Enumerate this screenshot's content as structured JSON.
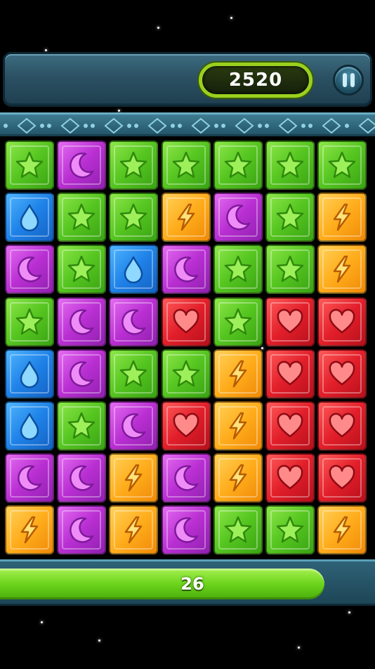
{
  "hud": {
    "score": "2520",
    "pause_icon": "pause-icon"
  },
  "moves": {
    "label": "26",
    "progress_fraction": 0.865
  },
  "colors": {
    "green": "#55c520",
    "purple": "#b92fd2",
    "blue": "#1f82e8",
    "orange": "#ffad1c",
    "red": "#e21f2a",
    "score_ring": "#9ad01e"
  },
  "tile_types": {
    "G": {
      "color": "green",
      "icon": "star-icon"
    },
    "P": {
      "color": "purple",
      "icon": "moon-icon"
    },
    "B": {
      "color": "blue",
      "icon": "drop-icon"
    },
    "O": {
      "color": "orange",
      "icon": "lightning-icon"
    },
    "R": {
      "color": "red",
      "icon": "heart-icon"
    }
  },
  "board": [
    [
      "G",
      "P",
      "G",
      "G",
      "G",
      "G",
      "G"
    ],
    [
      "B",
      "G",
      "G",
      "O",
      "P",
      "G",
      "O"
    ],
    [
      "P",
      "G",
      "B",
      "P",
      "G",
      "G",
      "O"
    ],
    [
      "G",
      "P",
      "P",
      "R",
      "G",
      "R",
      "R"
    ],
    [
      "B",
      "P",
      "G",
      "G",
      "O",
      "R",
      "R"
    ],
    [
      "B",
      "G",
      "P",
      "R",
      "O",
      "R",
      "R"
    ],
    [
      "P",
      "P",
      "O",
      "P",
      "O",
      "R",
      "R"
    ],
    [
      "O",
      "P",
      "O",
      "P",
      "G",
      "G",
      "O"
    ]
  ]
}
